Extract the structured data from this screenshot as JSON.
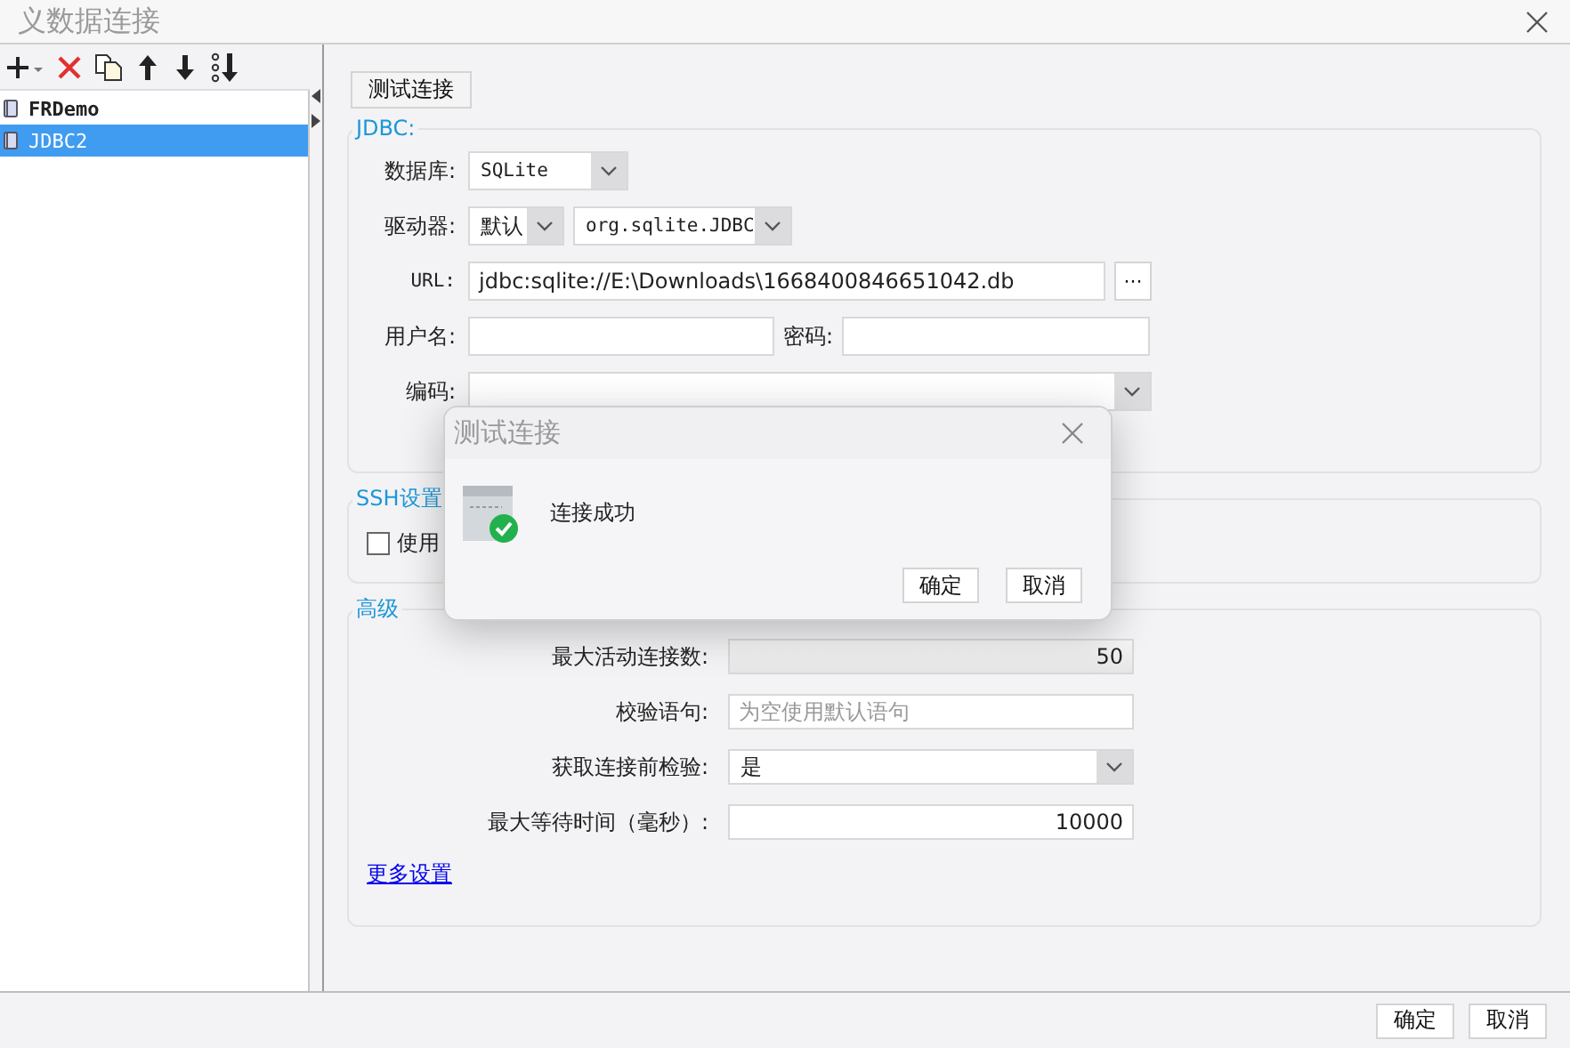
{
  "window": {
    "title": "义数据连接"
  },
  "connections": [
    {
      "name": "FRDemo",
      "selected": false
    },
    {
      "name": "JDBC2",
      "selected": true
    }
  ],
  "test_button": "测试连接",
  "jdbc": {
    "legend": "JDBC:",
    "database": {
      "label": "数据库:",
      "value": "SQLite"
    },
    "driver": {
      "label": "驱动器:",
      "mode": "默认",
      "class": "org.sqlite.JDBC"
    },
    "url": {
      "label": "URL:",
      "value": "jdbc:sqlite://E:\\Downloads\\1668400846651042.db",
      "browse": "···"
    },
    "username": {
      "label": "用户名:"
    },
    "password": {
      "label": "密码:"
    },
    "encoding": {
      "label": "编码:"
    }
  },
  "ssh": {
    "legend": "SSH设置",
    "checkbox": {
      "label": "使用",
      "checked": false
    }
  },
  "advanced": {
    "legend": "高级",
    "rows": [
      {
        "kind": "number",
        "label": "最大活动连接数:",
        "value": "50",
        "disabled": true
      },
      {
        "kind": "text",
        "label": "校验语句:",
        "placeholder": "为空使用默认语句",
        "disabled": false
      },
      {
        "kind": "select",
        "label": "获取连接前检验:",
        "value": "是",
        "disabled": false
      },
      {
        "kind": "number",
        "label": "最大等待时间（毫秒）:",
        "value": "10000",
        "disabled": false
      }
    ],
    "link": "更多设置"
  },
  "footer": {
    "buttons": [
      "确定",
      "取消"
    ]
  },
  "dialog": {
    "title": "测试连接",
    "message": "连接成功",
    "buttons": [
      "确定",
      "取消"
    ]
  }
}
